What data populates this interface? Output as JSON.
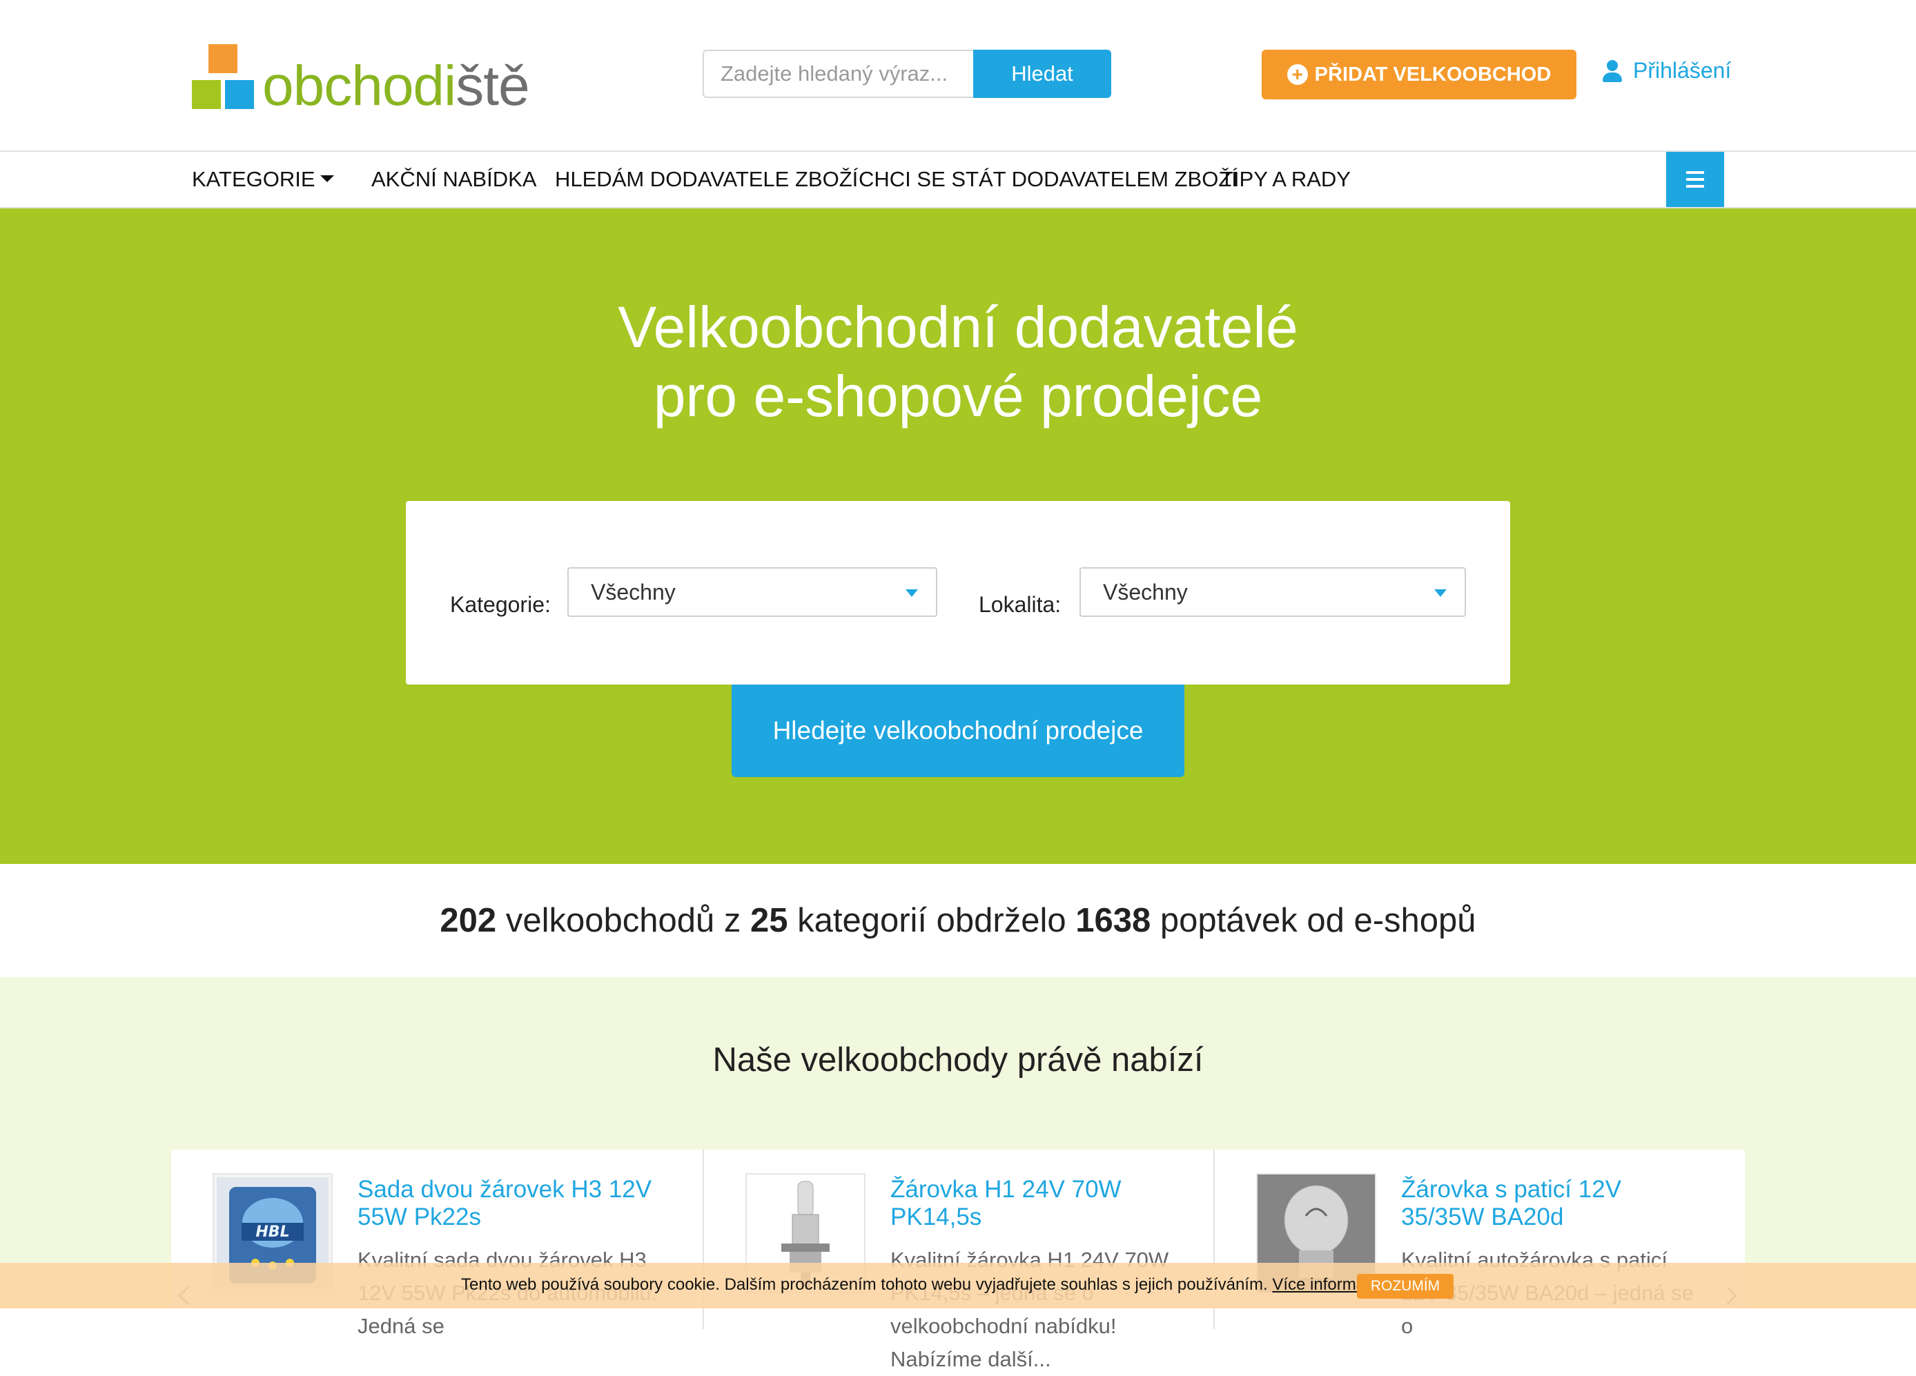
{
  "brand": {
    "name_part1": "obchodi",
    "name_part2": "ště",
    "colors": {
      "green": "#a6c724",
      "blue": "#1ea6e0",
      "orange": "#f59a2a"
    }
  },
  "header": {
    "search_placeholder": "Zadejte hledaný výraz...",
    "search_button": "Hledat",
    "add_button": "PŘIDAT VELKOOBCHOD",
    "login": "Přihlášení"
  },
  "nav": {
    "items": [
      "KATEGORIE",
      "AKČNÍ NABÍDKA",
      "HLEDÁM DODAVATELE ZBOŽÍ",
      "CHCI SE STÁT DODAVATELEM ZBOŽÍ",
      "TIPY A RADY"
    ]
  },
  "hero": {
    "title_line1": "Velkoobchodní dodavatelé",
    "title_line2": "pro e-shopové prodejce",
    "category_label": "Kategorie:",
    "category_value": "Všechny",
    "location_label": "Lokalita:",
    "location_value": "Všechny",
    "search_button": "Hledejte velkoobchodní prodejce"
  },
  "stats": {
    "wholesalers": "202",
    "text1": "velkoobchodů z",
    "categories": "25",
    "text2": "kategorií obdrželo",
    "inquiries": "1638",
    "text3": "poptávek od e-shopů"
  },
  "offers": {
    "title": "Naše velkoobchody právě nabízí",
    "items": [
      {
        "title": "Sada dvou žárovek H3 12V 55W Pk22s",
        "desc": "Kvalitní sada dvou žárovek H3 12V 55W Pk22s do automobilu. Jedná se"
      },
      {
        "title": "Žárovka H1 24V 70W PK14,5s",
        "desc": "Kvalitní žárovka H1 24V 70W PK14,5s – jedná se o velkoobchodní nabídku! Nabízíme další..."
      },
      {
        "title": "Žárovka s paticí 12V 35/35W BA20d",
        "desc": "Kvalitní autožárovka s paticí 12V 35/35W BA20d – jedná se o"
      }
    ]
  },
  "cookie": {
    "text": "Tento web používá soubory cookie. Dalším procházením tohoto webu vyjadřujete souhlas s jejich používáním.",
    "link": "Více informací zde",
    "button": "ROZUMÍM"
  }
}
